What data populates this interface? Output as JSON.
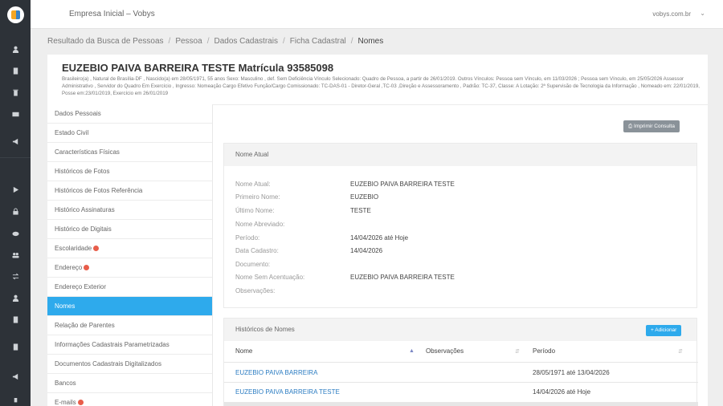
{
  "app": {
    "company": "Empresa Inicial – Vobys",
    "user": "vobys.com.br",
    "user_caret": "⌄"
  },
  "breadcrumb": [
    "Resultado da Busca de Pessoas",
    "Pessoa",
    "Dados Cadastrais",
    "Ficha Cadastral",
    "Nomes"
  ],
  "header": {
    "name": "EUZEBIO PAIVA BARREIRA TESTE Matrícula 93585098",
    "info": "Brasileiro(a) , Natural de Brasília-DF , Nascido(a) em 28/05/1971, 55 anos Sexo: Masculino , def. Sem Deficiência Vínculo Selecionado: Quadro de Pessoa, a partir de 26/01/2019. Outros Vínculos: Pessoa sem Vínculo, em 11/03/2026 ; Pessoa sem Vínculo, em 25/05/2026 Assessor Administrativo , Servidor do Quadro Em Exercício , Ingresso: Nomeação Cargo Efetivo Função/Cargo Comissionado: TC-DAS-01 - Diretor-Geral ,TC-03 ,Direção e Assessoramento , Padrão: TC-37, Classe: A Lotação: 2ª Supervisão de Tecnologia da Informação , Nomeado em: 22/01/2019, Posse em:23/01/2019, Exercício em 26/01/2019"
  },
  "menu": [
    {
      "label": "Dados Pessoais",
      "alert": false
    },
    {
      "label": "Estado Civil",
      "alert": false
    },
    {
      "label": "Características Físicas",
      "alert": false
    },
    {
      "label": "Históricos de Fotos",
      "alert": false
    },
    {
      "label": "Históricos de Fotos Referência",
      "alert": false
    },
    {
      "label": "Histórico Assinaturas",
      "alert": false
    },
    {
      "label": "Histórico de Digitais",
      "alert": false
    },
    {
      "label": "Escolaridade",
      "alert": true
    },
    {
      "label": "Endereço",
      "alert": true
    },
    {
      "label": "Endereço Exterior",
      "alert": false
    },
    {
      "label": "Nomes",
      "alert": false,
      "active": true
    },
    {
      "label": "Relação de Parentes",
      "alert": false
    },
    {
      "label": "Informações Cadastrais Parametrizadas",
      "alert": false
    },
    {
      "label": "Documentos Cadastrais Digitalizados",
      "alert": false
    },
    {
      "label": "Bancos",
      "alert": false
    },
    {
      "label": "E-mails",
      "alert": true
    }
  ],
  "actions": {
    "print": "Imprimir Consulta",
    "add": "+ Adicionar"
  },
  "nome_atual": {
    "title": "Nome Atual",
    "fields": [
      {
        "label": "Nome Atual:",
        "value": "EUZEBIO PAIVA BARREIRA TESTE"
      },
      {
        "label": "Primeiro Nome:",
        "value": "EUZEBIO"
      },
      {
        "label": "Último Nome:",
        "value": "TESTE"
      },
      {
        "label": "Nome Abreviado:",
        "value": ""
      },
      {
        "label": "Período:",
        "value": "14/04/2026 até Hoje"
      },
      {
        "label": "Data Cadastro:",
        "value": "14/04/2026"
      },
      {
        "label": "Documento:",
        "value": ""
      },
      {
        "label": "Nome Sem Acentuação:",
        "value": "EUZEBIO PAIVA BARREIRA TESTE"
      },
      {
        "label": "Observações:",
        "value": ""
      }
    ]
  },
  "historico": {
    "title": "Históricos de Nomes",
    "columns": [
      "Nome",
      "Observações",
      "Período"
    ],
    "rows": [
      {
        "nome": "EUZEBIO PAIVA BARREIRA",
        "obs": "",
        "periodo": "28/05/1971 até 13/04/2026"
      },
      {
        "nome": "EUZEBIO PAIVA BARREIRA TESTE",
        "obs": "",
        "periodo": "14/04/2026 até Hoje"
      }
    ]
  }
}
